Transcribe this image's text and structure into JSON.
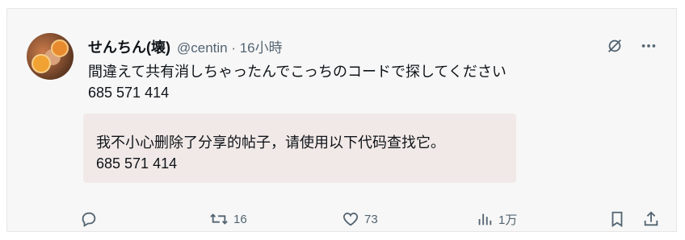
{
  "post": {
    "author_name": "せんちん(壊)",
    "handle_time": "@centin · 16小時",
    "text_line1": "間違えて共有消しちゃったんでこっちのコードで探してください",
    "text_line2": "685 571 414",
    "quote_line1": "我不小心删除了分享的帖子，请使用以下代码查找它。",
    "quote_line2": "685 571 414"
  },
  "actions": {
    "reply_count": "",
    "repost_count": "16",
    "like_count": "73",
    "views_count": "1万"
  },
  "icons": {
    "grok": "grok-icon",
    "more": "more-icon",
    "reply": "reply-icon",
    "repost": "repost-icon",
    "like": "like-icon",
    "views": "views-icon",
    "bookmark": "bookmark-icon",
    "share": "share-icon"
  },
  "colors": {
    "text": "#0f1419",
    "muted": "#536471",
    "quote_bg": "#f1e9e7"
  }
}
